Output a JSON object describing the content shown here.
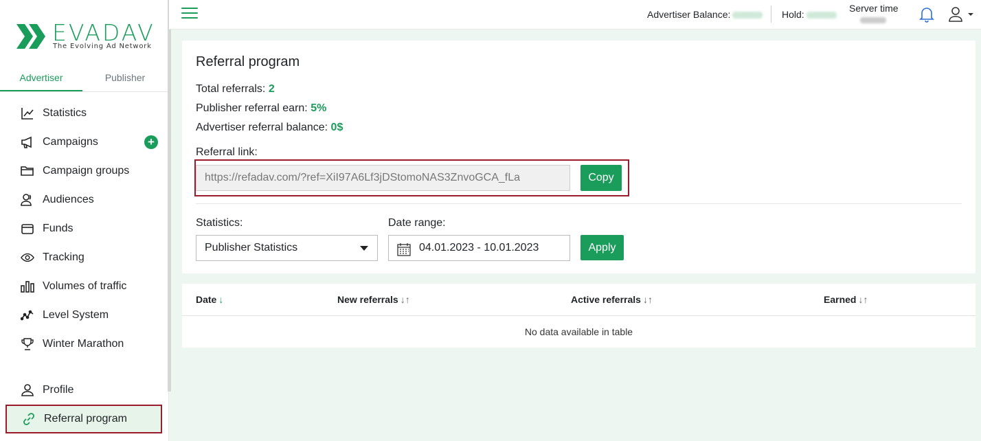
{
  "brand": {
    "name": "EVADAV",
    "tagline": "The Evolving Ad Network",
    "accent": "#1a9c5a"
  },
  "sidebar": {
    "tabs": [
      {
        "label": "Advertiser",
        "active": true
      },
      {
        "label": "Publisher",
        "active": false
      }
    ],
    "items": [
      {
        "label": "Statistics",
        "icon": "chart-line-icon"
      },
      {
        "label": "Campaigns",
        "icon": "megaphone-icon",
        "action": "+"
      },
      {
        "label": "Campaign groups",
        "icon": "folder-icon"
      },
      {
        "label": "Audiences",
        "icon": "people-icon"
      },
      {
        "label": "Funds",
        "icon": "wallet-icon"
      },
      {
        "label": "Tracking",
        "icon": "eye-icon"
      },
      {
        "label": "Volumes of traffic",
        "icon": "bar-chart-icon"
      },
      {
        "label": "Level System",
        "icon": "level-graph-icon"
      },
      {
        "label": "Winter Marathon",
        "icon": "trophy-icon"
      }
    ],
    "bottom": [
      {
        "label": "Profile",
        "icon": "user-icon"
      },
      {
        "label": "Referral program",
        "icon": "link-icon",
        "selected": true
      }
    ]
  },
  "topbar": {
    "balance_label": "Advertiser Balance:",
    "hold_label": "Hold:",
    "server_time_label": "Server time"
  },
  "referral": {
    "title": "Referral program",
    "total_label": "Total referrals:",
    "total_value": "2",
    "publisher_label": "Publisher referral earn:",
    "publisher_value": "5%",
    "advertiser_label": "Advertiser referral balance:",
    "advertiser_value": "0$",
    "link_label": "Referral link:",
    "link_value": "https://refadav.com/?ref=XiI97A6Lf3jDStomoNAS3ZnvoGCA_fLa",
    "copy_label": "Copy",
    "statistics_label": "Statistics:",
    "statistics_value": "Publisher Statistics",
    "date_label": "Date range:",
    "date_value": "04.01.2023 - 10.01.2023",
    "apply_label": "Apply"
  },
  "table": {
    "columns": [
      {
        "label": "Date",
        "sort": "↓"
      },
      {
        "label": "New referrals",
        "sort": "↓↑"
      },
      {
        "label": "Active referrals",
        "sort": "↓↑"
      },
      {
        "label": "Earned",
        "sort": "↓↑"
      }
    ],
    "empty_text": "No data available in table"
  }
}
